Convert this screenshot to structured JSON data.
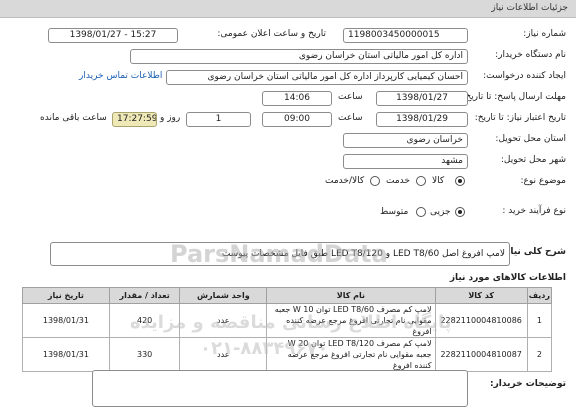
{
  "header": {
    "title": "جزئیات اطلاعات نیاز"
  },
  "form": {
    "need_number_label": "شماره نیاز:",
    "need_number": "1198003450000015",
    "announce_label": "تاریخ و ساعت اعلان عمومی:",
    "announce_value": "1398/01/27 - 15:27",
    "buyer_org_label": "نام دستگاه خریدار:",
    "buyer_org": "اداره کل امور مالیاتی استان خراسان رضوی",
    "creator_label": "ایجاد کننده درخواست:",
    "creator": "احسان کیمیایی کارپرداز اداره کل امور مالیاتی استان خراسان رضوی",
    "contact_link": "اطلاعات تماس خریدار",
    "reply_deadline_label": "مهلت ارسال پاسخ: تا تاریخ:",
    "reply_date": "1398/01/27",
    "hour_label": "ساعت",
    "reply_time": "14:06",
    "validity_label": "تاریخ اعتبار نیاز: تا تاریخ:",
    "validity_date": "1398/01/29",
    "validity_time": "09:00",
    "days": "1",
    "day_and_label": "روز و",
    "timer": "17:27:59",
    "remaining_label": "ساعت باقی مانده",
    "province_label": "استان محل تحویل:",
    "province": "خراسان رضوی",
    "city_label": "شهر محل تحویل:",
    "city": "مشهد",
    "category_label": "موضوع نوع:",
    "category_options": [
      "کالا",
      "خدمت",
      "کالا/خدمت"
    ],
    "category_selected": "کالا",
    "process_label": "نوع فرآیند خرید :",
    "process_options": [
      "جزیی",
      "متوسط"
    ],
    "process_selected": "جزیی"
  },
  "summary": {
    "label": "شرح کلی نیاز:",
    "value": "لامپ افروغ اصل LED T8/60 و LED T8/120 طبق فایل مشخصات پیوست"
  },
  "items": {
    "title": "اطلاعات کالاهای مورد نیاز",
    "headers": [
      "ردیف",
      "کد کالا",
      "نام کالا",
      "واحد شمارش",
      "تعداد / مقدار",
      "تاریخ نیاز"
    ],
    "rows": [
      {
        "index": "1",
        "code": "2282110004810086",
        "name": "لامپ کم مصرف LED T8/60 توان 10 W جعبه مقوایی نام تجارتی افروغ مرجع عرضه کننده افروغ",
        "unit": "عدد",
        "qty": "420",
        "date": "1398/01/31"
      },
      {
        "index": "2",
        "code": "2282110004810087",
        "name": "لامپ کم مصرف LED T8/120 توان 20 W جعبه مقوایی نام تجارتی افروغ مرجع عرضه کننده افروغ",
        "unit": "عدد",
        "qty": "330",
        "date": "1398/01/31"
      }
    ]
  },
  "buyer_notes": {
    "label": "توضیحات خریدار:",
    "value": ""
  },
  "watermark": {
    "brand": "ParsNamadData",
    "line1": "پایگاه اطلاع رسانی مناقصه و مزایده",
    "line2": "۰۲۱-۸۸۳۴۹۶۷۰"
  }
}
